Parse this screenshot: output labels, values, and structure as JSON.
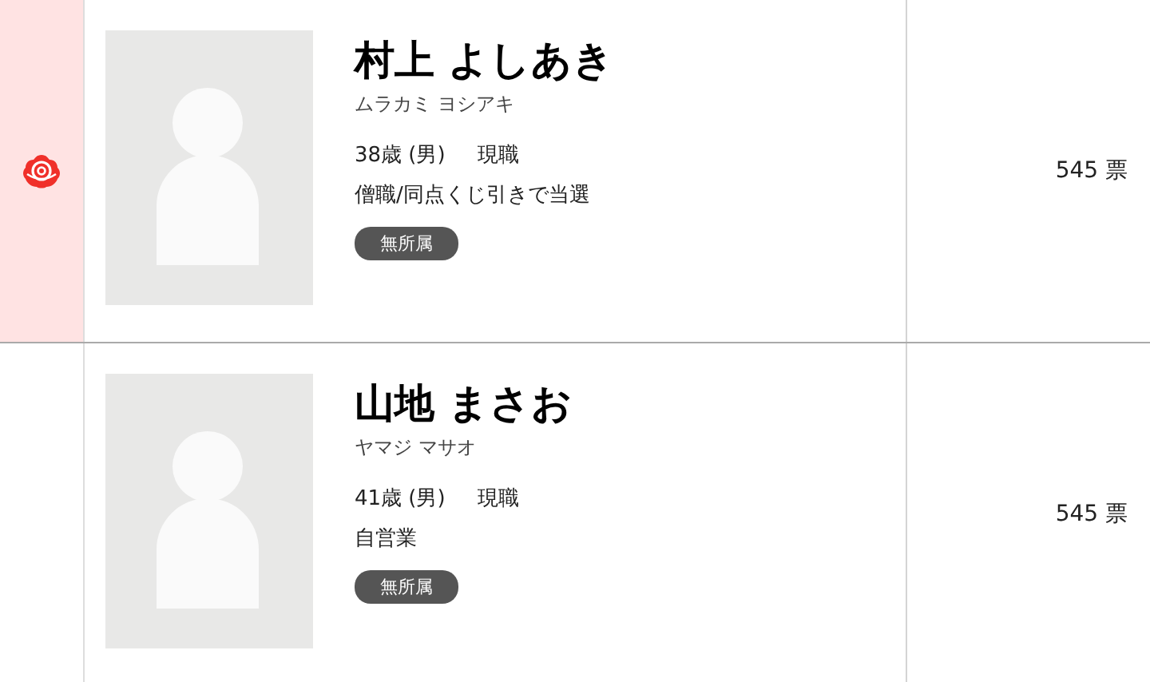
{
  "candidates": [
    {
      "elected": true,
      "name": "村上 よしあき",
      "kana": "ムラカミ ヨシアキ",
      "age_sex": "38歳 (男)",
      "status": "現職",
      "occupation": "僧職/同点くじ引きで当選",
      "party": "無所属",
      "votes": "545 票"
    },
    {
      "elected": false,
      "name": "山地 まさお",
      "kana": "ヤマジ マサオ",
      "age_sex": "41歳 (男)",
      "status": "現職",
      "occupation": "自営業",
      "party": "無所属",
      "votes": "545 票"
    }
  ]
}
